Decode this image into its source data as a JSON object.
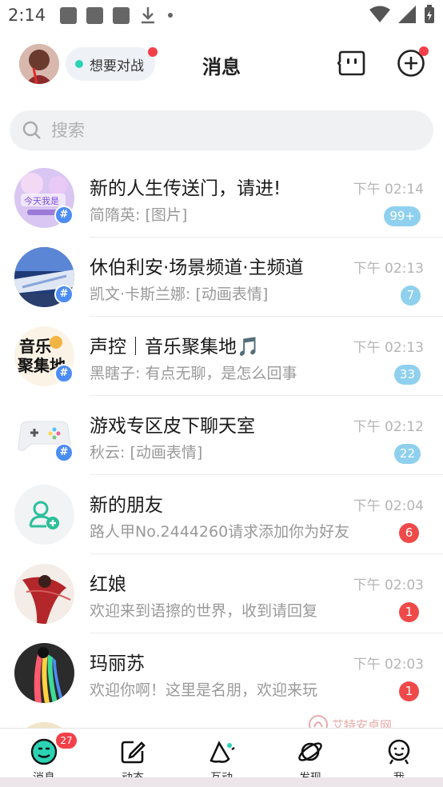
{
  "status_bar": {
    "time": "2:14"
  },
  "header": {
    "status_label": "想要对战",
    "title": "消息"
  },
  "search": {
    "placeholder": "搜索"
  },
  "conversations": [
    {
      "title": "新的人生传送门，请进!",
      "preview": "简隋英: [图片]",
      "time": "下午 02:14",
      "badge": "99+",
      "badge_color": "blue",
      "is_channel": true
    },
    {
      "title": "休伯利安·场景频道·主频道",
      "preview": "凯文·卡斯兰娜: [动画表情]",
      "time": "下午 02:13",
      "badge": "7",
      "badge_color": "blue",
      "is_channel": true
    },
    {
      "title": "声控｜音乐聚集地🎵",
      "preview": "黑瞎子: 有点无聊，是怎么回事",
      "time": "下午 02:13",
      "badge": "33",
      "badge_color": "blue",
      "is_channel": true
    },
    {
      "title": "游戏专区皮下聊天室",
      "preview": "秋云: [动画表情]",
      "time": "下午 02:12",
      "badge": "22",
      "badge_color": "blue",
      "is_channel": true
    },
    {
      "title": "新的朋友",
      "preview": "路人甲No.2444260请求添加你为好友",
      "time": "下午 02:04",
      "badge": "6",
      "badge_color": "red",
      "is_channel": false
    },
    {
      "title": "红娘",
      "preview": "欢迎来到语擦的世界，收到请回复",
      "time": "下午 02:03",
      "badge": "1",
      "badge_color": "red",
      "is_channel": false
    },
    {
      "title": "玛丽苏",
      "preview": "欢迎你啊！这里是名朋，欢迎来玩",
      "time": "下午 02:03",
      "badge": "1",
      "badge_color": "red",
      "is_channel": false
    }
  ],
  "avatar_texts": {
    "music_line1": "音乐",
    "music_line2": "聚集地",
    "portal": "今天我是"
  },
  "watermark": {
    "text": "艾特安卓网"
  },
  "tabbar": {
    "tabs": [
      {
        "label": "消息",
        "icon": "chat-bubble-icon",
        "badge": "27",
        "active": true
      },
      {
        "label": "动态",
        "icon": "edit-icon"
      },
      {
        "label": "互动",
        "icon": "interact-icon"
      },
      {
        "label": "发现",
        "icon": "planet-icon"
      },
      {
        "label": "我",
        "icon": "profile-icon"
      }
    ]
  },
  "colors": {
    "accent_teal": "#2bd3b4",
    "badge_red": "#ef4a4a",
    "badge_blue": "#8fd0ee",
    "channel_tag": "#4c8cf5"
  }
}
